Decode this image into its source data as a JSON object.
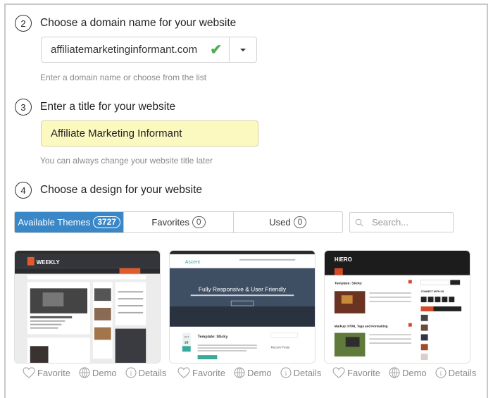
{
  "steps": [
    {
      "number": "2",
      "title": "Choose a domain name for your website"
    },
    {
      "number": "3",
      "title": "Enter a title for your website"
    },
    {
      "number": "4",
      "title": "Choose a design for your website"
    }
  ],
  "domain": {
    "value": "affiliatemarketinginformant.com",
    "hint": "Enter a domain name or choose from the list",
    "valid_color": "#4caf50"
  },
  "site_title": {
    "value": "Affiliate Marketing Informant",
    "hint": "You can always change your website title later"
  },
  "tabs": [
    {
      "label": "Available Themes",
      "count": "3727",
      "active": true
    },
    {
      "label": "Favorites",
      "count": "0",
      "active": false
    },
    {
      "label": "Used",
      "count": "0",
      "active": false
    }
  ],
  "search": {
    "placeholder": "Search..."
  },
  "themes": [
    {
      "name": "Weekly",
      "headline": "WEEKLY"
    },
    {
      "name": "Ascent",
      "headline": "Fully Responsive & User Friendly",
      "post_title": "Template: Sticky",
      "date_month": "OCT",
      "date_day": "26",
      "sidebar": "Recent Posts"
    },
    {
      "name": "Hiero",
      "headline": "HIERO",
      "post_title": "Template: Sticky",
      "post_title_2": "Markup: HTML Tags and Formatting",
      "sidebar": "CONNECT WITH US"
    }
  ],
  "card_actions": {
    "favorite": "Favorite",
    "demo": "Demo",
    "details": "Details"
  },
  "colors": {
    "accent": "#3a87c8",
    "title_bg": "#fbf8c0"
  }
}
